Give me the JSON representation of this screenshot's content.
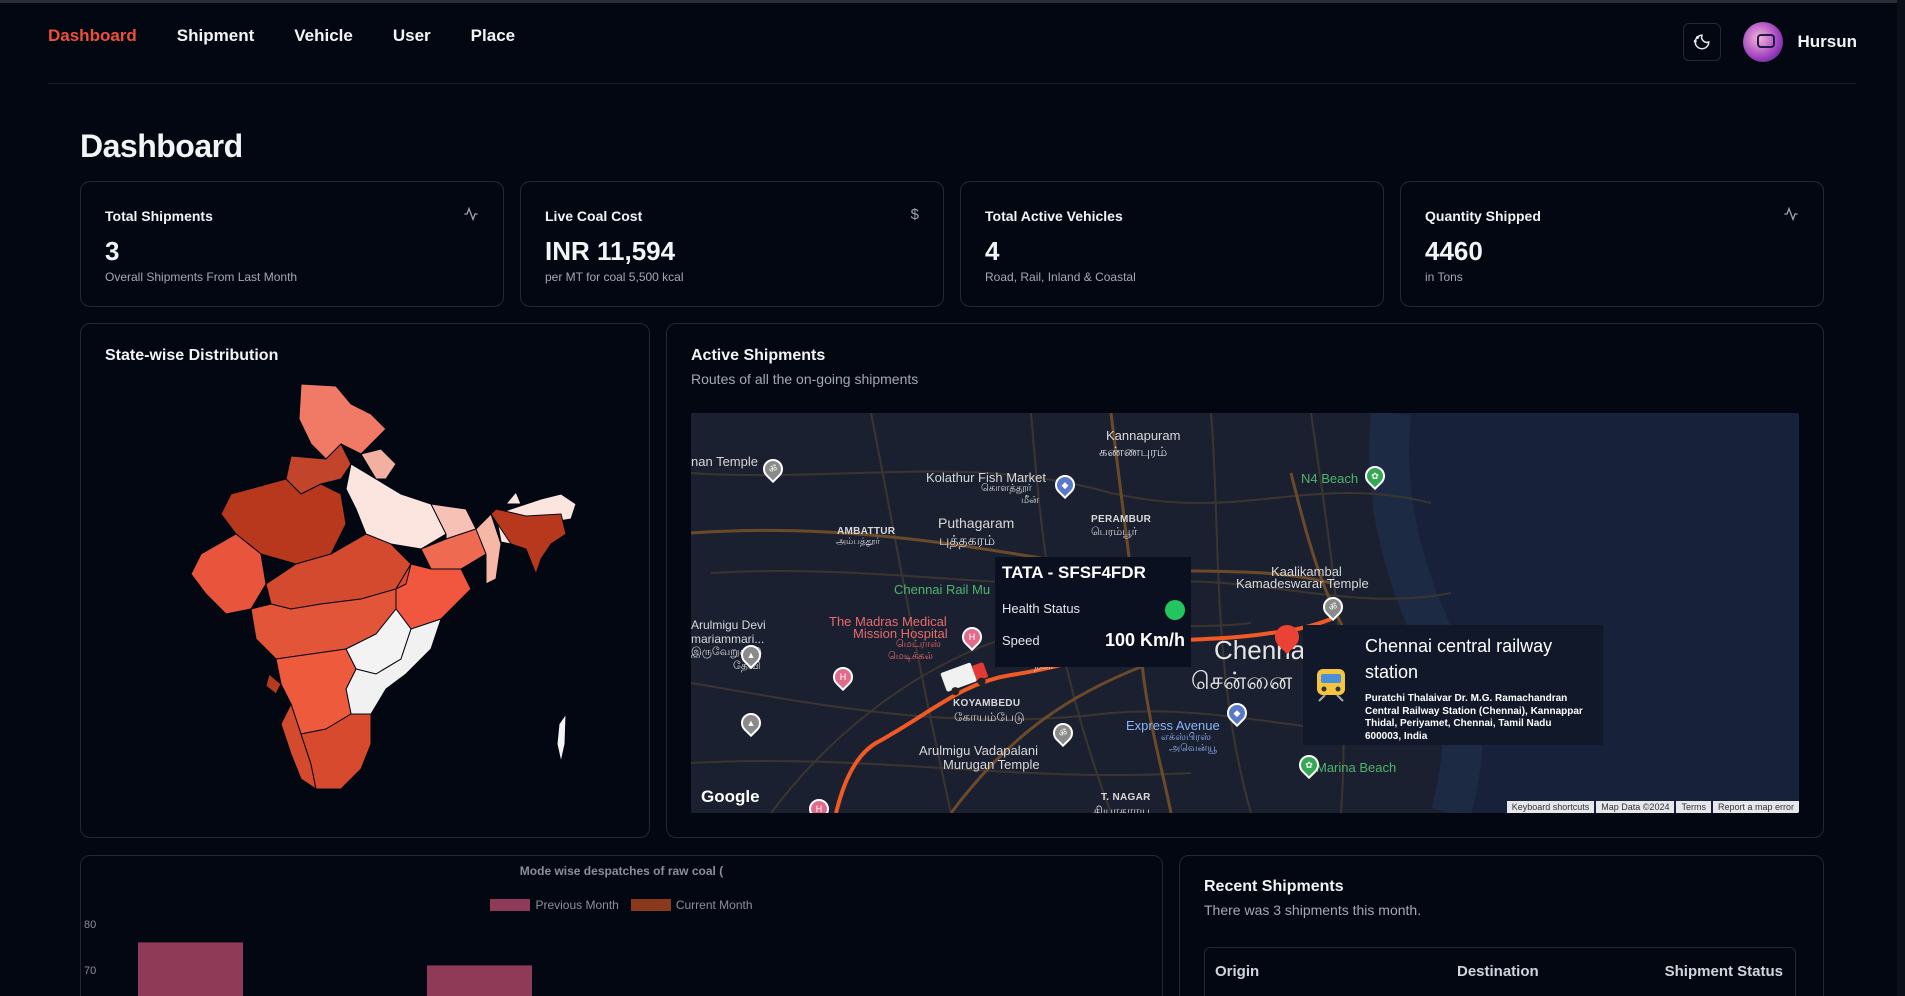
{
  "nav": {
    "items": [
      "Dashboard",
      "Shipment",
      "Vehicle",
      "User",
      "Place"
    ],
    "active": "Dashboard",
    "user": "Hursun"
  },
  "page_title": "Dashboard",
  "stats": [
    {
      "label": "Total Shipments",
      "value": "3",
      "sub": "Overall Shipments From Last Month",
      "icon": "activity-icon"
    },
    {
      "label": "Live Coal Cost",
      "value": "INR 11,594",
      "sub": "per MT for coal 5,500 kcal",
      "icon": "dollar-icon"
    },
    {
      "label": "Total Active Vehicles",
      "value": "4",
      "sub": "Road, Rail, Inland & Coastal",
      "icon": ""
    },
    {
      "label": "Quantity Shipped",
      "value": "4460",
      "sub": "in Tons",
      "icon": "activity-icon"
    }
  ],
  "state_card": {
    "title": "State-wise Distribution"
  },
  "active_card": {
    "title": "Active Shipments",
    "subtitle": "Routes of all the on-going shipments",
    "vehicle_popup": {
      "id": "TATA - SFSF4FDR",
      "health_label": "Health Status",
      "speed_label": "Speed",
      "speed": "100 Km/h",
      "health_color": "#22c55e"
    },
    "station_popup": {
      "name": "Chennai central railway station",
      "address": "Puratchi Thalaivar Dr. M.G. Ramachandran Central Railway Station (Chennai), Kannappar Thidal, Periyamet, Chennai, Tamil Nadu 600003, India"
    },
    "map_labels": {
      "kannapuram": "Kannapuram",
      "kannapuram_ta": "கண்ணபுரம்",
      "kolathur": "Kolathur Fish Market",
      "kolathur_ta": "கொளத்தூர்",
      "kolathur_ta2": "மீன்",
      "n4": "N4 Beach",
      "ambattur": "AMBATTUR",
      "ambattur_ta": "அம்பத்தூர்",
      "puthagaram": "Puthagaram",
      "puthagaram_ta": "புத்தகரம்",
      "perambur": "PERAMBUR",
      "perambur_ta": "பெரம்பூர்",
      "temple_left": "nan Temple",
      "chennai_rail": "Chennai Rail Mu",
      "kaalikambal": "Kaalikambal",
      "kaalikambal2": "Kamadeswarar Temple",
      "arulmigu1": "Arulmigu Devi",
      "arulmigu1b": "mariammari...",
      "arulmigu1c": "இருவேறுகாடு",
      "arulmigu1d": "தேவி",
      "madras": "The Madras Medical",
      "madras2": "Mission Hospital",
      "madras_ta": "மெட்ராஸ்",
      "madras_ta2": "மெடிக்கல்",
      "nagar": "நகர்",
      "chennai": "Chennai",
      "chennai_ta": "சென்னை",
      "koyambedu": "KOYAMBEDU",
      "koyambedu_ta": "கோயம்பேடு",
      "express": "Express Avenue",
      "express_ta": "எக்ஸ்பிரஸ்",
      "express_ta2": "அவென்யூ",
      "vadapalani": "Arulmigu Vadapalani",
      "vadapalani2": "Murugan Temple",
      "marina": "Marina Beach",
      "tnagar": "T. NAGAR",
      "tnagar_ta": "தியாகராய"
    },
    "google": "Google",
    "footer": [
      "Keyboard shortcuts",
      "Map Data ©2024",
      "Terms",
      "Report a map error"
    ]
  },
  "chart_data": {
    "type": "bar",
    "title": "Mode wise despatches of raw coal (",
    "series": [
      {
        "name": "Previous Month",
        "color": "#8f3a57",
        "values": [
          76,
          71
        ]
      },
      {
        "name": "Current Month",
        "color": "#8a3a1c",
        "values": []
      }
    ],
    "yticks": [
      80,
      70
    ]
  },
  "recent": {
    "title": "Recent Shipments",
    "subtitle": "There was 3 shipments this month.",
    "columns": [
      "Origin",
      "Destination",
      "Shipment Status"
    ]
  }
}
